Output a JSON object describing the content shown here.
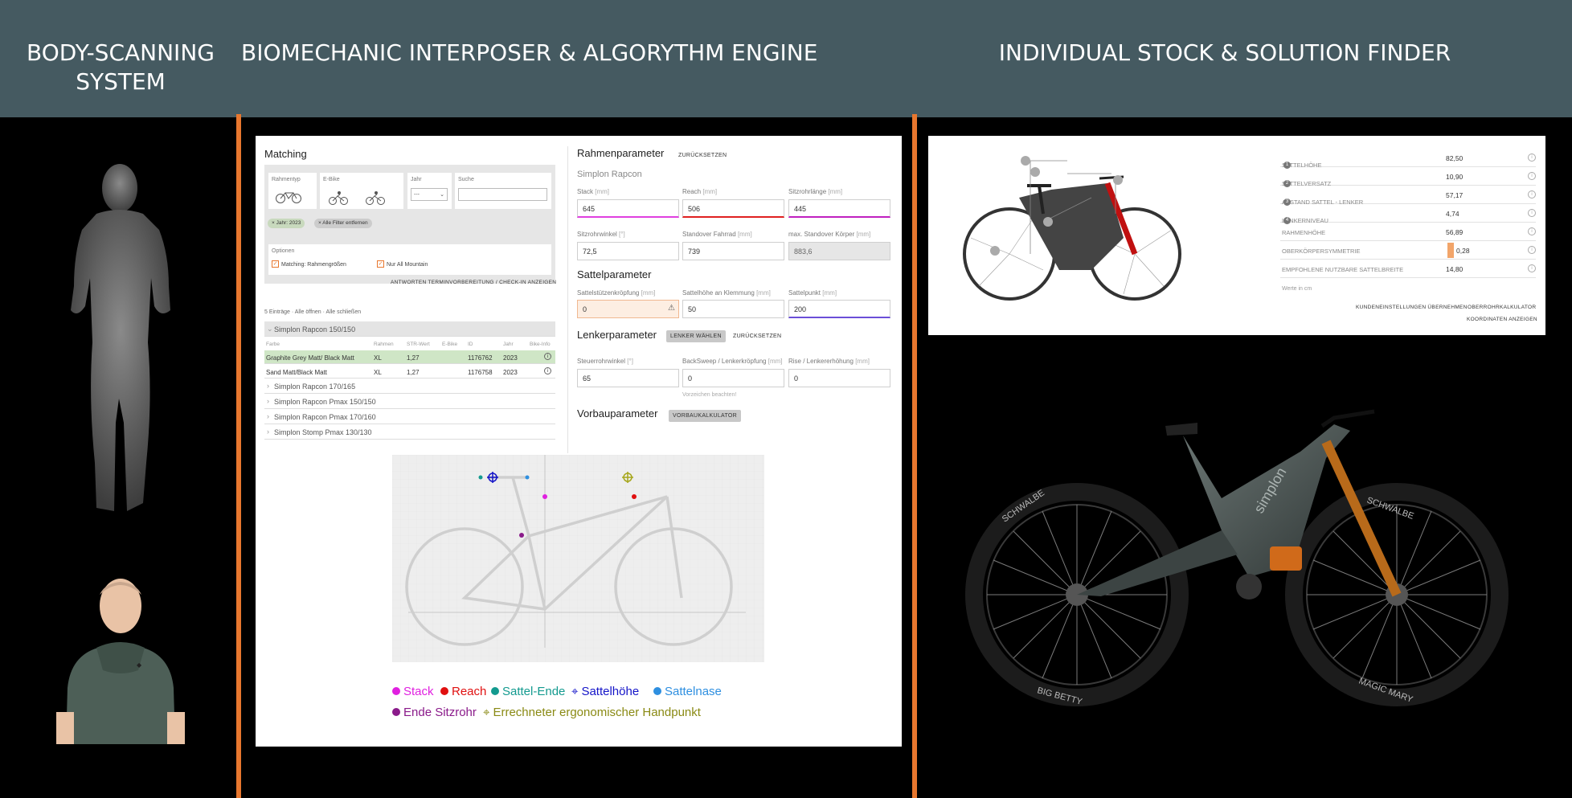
{
  "banner": {
    "col1": "BODY-SCANNING SYSTEM",
    "col2": "BIOMECHANIC INTERPOSER & ALGORYTHM ENGINE",
    "col3": "INDIVIDUAL STOCK & SOLUTION FINDER"
  },
  "colors": {
    "banner_bg": "#455a61",
    "accent": "#e8772e",
    "selected_row": "#cfe6c6"
  },
  "matching": {
    "title": "Matching",
    "rahmentyp_label": "Rahmentyp",
    "ebike_label": "E-Bike",
    "jahr_label": "Jahr",
    "jahr_value": "---",
    "suche_label": "Suche",
    "chip_year": "Jahr: 2023",
    "chip_clear": "Alle Filter entfernen",
    "options_label": "Optionen",
    "opt1": "Matching: Rahmengrößen",
    "opt2": "Nur All Mountain",
    "answers_link": "ANTWORTEN TERMINVORBEREITUNG / CHECK-IN ANZEIGEN",
    "entries": "5 Einträge · Alle öffnen · Alle schließen",
    "group_open": "Simplon Rapcon 150/150",
    "table_headers": [
      "Farbe",
      "Rahmen",
      "STR-Wert",
      "E-Bike",
      "ID",
      "Jahr",
      "Bike-Info"
    ],
    "rows": [
      {
        "farbe": "Graphite Grey Matt/ Black Matt",
        "rahmen": "XL",
        "str": "1,27",
        "ebike": "",
        "id": "1176762",
        "jahr": "2023"
      },
      {
        "farbe": "Sand Matt/Black Matt",
        "rahmen": "XL",
        "str": "1,27",
        "ebike": "",
        "id": "1176758",
        "jahr": "2023"
      }
    ],
    "groups": [
      "Simplon Rapcon 170/165",
      "Simplon Rapcon Pmax 150/150",
      "Simplon Rapcon Pmax 170/160",
      "Simplon Stomp Pmax 130/130"
    ]
  },
  "rahmen": {
    "title": "Rahmenparameter",
    "reset": "ZURÜCKSETZEN",
    "model": "Simplon Rapcon",
    "stack_label": "Stack",
    "stack_unit": "[mm]",
    "stack": "645",
    "reach_label": "Reach",
    "reach_unit": "[mm]",
    "reach": "506",
    "sitzrohr_label": "Sitzrohrlänge",
    "sitzrohr_unit": "[mm]",
    "sitzrohr": "445",
    "winkel_label": "Sitzrohrwinkel",
    "winkel_unit": "[°]",
    "winkel": "72,5",
    "standover_label": "Standover Fahrrad",
    "standover_unit": "[mm]",
    "standover": "739",
    "maxstand_label": "max. Standover Körper",
    "maxstand_unit": "[mm]",
    "maxstand": "883,6"
  },
  "sattel": {
    "title": "Sattelparameter",
    "kropf_label": "Sattelstützenkröpfung",
    "kropf_unit": "[mm]",
    "kropf": "0",
    "klemm_label": "Sattelhöhe an Klemmung",
    "klemm_unit": "[mm]",
    "klemm": "50",
    "punkt_label": "Sattelpunkt",
    "punkt_unit": "[mm]",
    "punkt": "200"
  },
  "lenker": {
    "title": "Lenkerparameter",
    "choose": "LENKER WÄHLEN",
    "reset": "ZURÜCKSETZEN",
    "steuer_label": "Steuerrohrwinkel",
    "steuer_unit": "[°]",
    "steuer": "65",
    "back_label": "BackSweep / Lenkerkröpfung",
    "back_unit": "[mm]",
    "back": "0",
    "rise_label": "Rise / Lenkererhöhung",
    "rise_unit": "[mm]",
    "rise": "0",
    "hint": "Vorzeichen beachten!"
  },
  "vorbau": {
    "title": "Vorbauparameter",
    "calc": "VORBAUKALKULATOR"
  },
  "legend": {
    "stack": "Stack",
    "reach": "Reach",
    "sattelende": "Sattel-Ende",
    "sattelhoehe": "Sattelhöhe",
    "sattelnase": "Sattelnase",
    "endesitzrohr": "Ende Sitzrohr",
    "handpunkt": "Errechneter ergonomischer Handpunkt"
  },
  "measures": {
    "rows": [
      {
        "label": "SATTELHÖHE",
        "badge": "1",
        "value": "82,50"
      },
      {
        "label": "SATTELVERSATZ",
        "badge": "2",
        "value": "10,90"
      },
      {
        "label": "ABSTAND SATTEL - LENKER",
        "badge": "3",
        "value": "57,17"
      },
      {
        "label": "LENKERNIVEAU",
        "badge": "4",
        "value": "4,74"
      },
      {
        "label": "RAHMENHÖHE",
        "badge": "",
        "value": "56,89"
      },
      {
        "label": "OBERKÖRPERSYMMETRIE",
        "badge": "",
        "value": "0,28"
      },
      {
        "label": "EMPFOHLENE NUTZBARE SATTELBREITE",
        "badge": "",
        "value": "14,80"
      }
    ],
    "unit_note": "Werte in cm",
    "btn_take": "KUNDENEINSTELLUNGEN ÜBERNEHMEN",
    "btn_calc": "OBERROHRKALKULATOR",
    "btn_coords": "KOORDINATEN ANZEIGEN"
  },
  "bike_labels": {
    "brand": "simplon",
    "tire_left": "SCHWALBE",
    "tire_right": "SCHWALBE",
    "tire_bottom_left": "BIG BETTY",
    "tire_bottom_right": "MAGIC MARY"
  }
}
